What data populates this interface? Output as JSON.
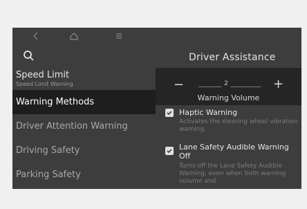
{
  "left": {
    "items": [
      {
        "label": "Speed Limit",
        "sub": "Speed Limit Warning"
      },
      {
        "label": "Warning Methods"
      },
      {
        "label": "Driver Attention Warning"
      },
      {
        "label": "Driving Safety"
      },
      {
        "label": "Parking Safety"
      }
    ]
  },
  "right": {
    "title": "Driver Assistance",
    "volume": {
      "minus": "−",
      "plus": "+",
      "value": "2",
      "label": "Warning Volume"
    },
    "options": [
      {
        "title": "Haptic Warning",
        "desc": "Activates the steering wheel vibration warning.",
        "checked": true
      },
      {
        "title": "Lane Safety Audible Warning Off",
        "desc": "Turns off the Lane Safety Audible Warning, even when both warning volume and",
        "checked": true
      }
    ]
  },
  "icons": {
    "back": "chevron-left-icon",
    "home": "home-icon",
    "menu": "menu-icon",
    "search": "search-icon"
  },
  "colors": {
    "background": "#3d3d3d",
    "selected": "#1e1e1e",
    "volume_panel": "#252525"
  }
}
